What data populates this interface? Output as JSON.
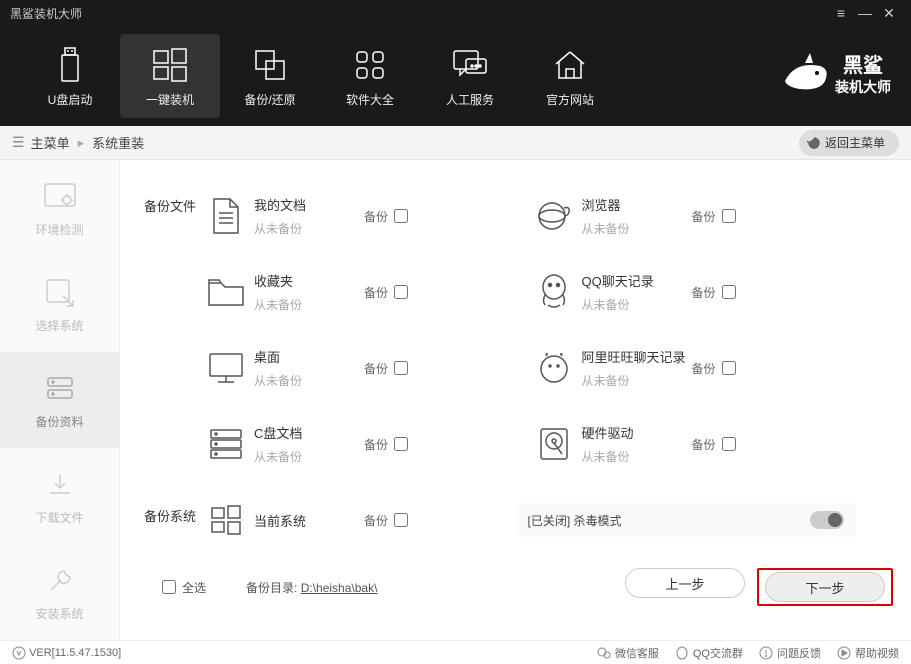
{
  "app_title": "黑鲨装机大师",
  "window_controls": {
    "menu": "≡",
    "min": "—",
    "close": "✕"
  },
  "topnav": [
    {
      "label": "U盘启动"
    },
    {
      "label": "一键装机"
    },
    {
      "label": "备份/还原"
    },
    {
      "label": "软件大全"
    },
    {
      "label": "人工服务"
    },
    {
      "label": "官方网站"
    }
  ],
  "brand": {
    "line1": "黑鲨",
    "line2": "装机大师"
  },
  "breadcrumb": {
    "root": "主菜单",
    "current": "系统重装",
    "back": "返回主菜单"
  },
  "sidebar": [
    {
      "label": "环境检测"
    },
    {
      "label": "选择系统"
    },
    {
      "label": "备份资料"
    },
    {
      "label": "下载文件"
    },
    {
      "label": "安装系统"
    }
  ],
  "sections": {
    "files": "备份文件",
    "system": "备份系统"
  },
  "backup_label": "备份",
  "never_backup": "从未备份",
  "items_left": [
    {
      "title": "我的文档"
    },
    {
      "title": "收藏夹"
    },
    {
      "title": "桌面"
    },
    {
      "title": "C盘文档"
    },
    {
      "title": "当前系统"
    }
  ],
  "items_right": [
    {
      "title": "浏览器"
    },
    {
      "title": "QQ聊天记录"
    },
    {
      "title": "阿里旺旺聊天记录"
    },
    {
      "title": "硬件驱动"
    }
  ],
  "antivirus": {
    "status": "[已关闭]",
    "label": "杀毒模式"
  },
  "bottom": {
    "select_all": "全选",
    "dir_label": "备份目录:",
    "dir_path": "D:\\heisha\\bak\\",
    "prev": "上一步",
    "next": "下一步"
  },
  "footer": {
    "version": "VER[11.5.47.1530]",
    "links": [
      {
        "label": "微信客服"
      },
      {
        "label": "QQ交流群"
      },
      {
        "label": "问题反馈"
      },
      {
        "label": "帮助视频"
      }
    ]
  }
}
